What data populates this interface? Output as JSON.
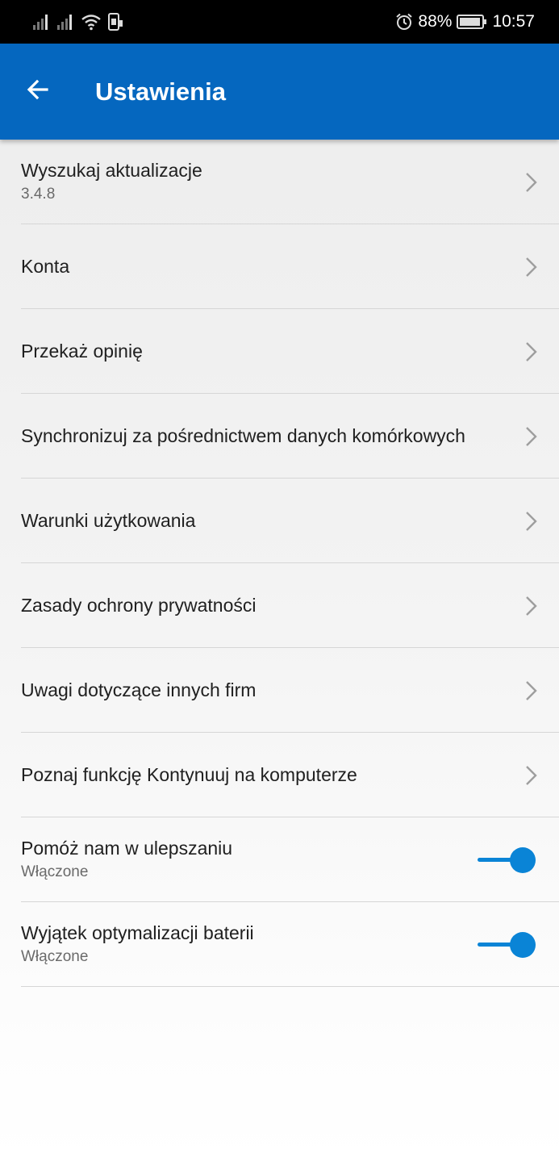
{
  "status_bar": {
    "battery_percent": "88%",
    "time": "10:57",
    "icons": [
      "signal-icon",
      "signal-icon",
      "wifi-icon",
      "sim-icon",
      "alarm-icon",
      "battery-icon"
    ]
  },
  "app_bar": {
    "title": "Ustawienia",
    "back_icon": "arrow-left-icon",
    "color": "#0567bf"
  },
  "settings": {
    "items": [
      {
        "title": "Wyszukaj aktualizacje",
        "subtitle": "3.4.8",
        "type": "link"
      },
      {
        "title": "Konta",
        "type": "link"
      },
      {
        "title": "Przekaż opinię",
        "type": "link"
      },
      {
        "title": "Synchronizuj za pośrednictwem danych komórkowych",
        "type": "link"
      },
      {
        "title": "Warunki użytkowania",
        "type": "link"
      },
      {
        "title": "Zasady ochrony prywatności",
        "type": "link"
      },
      {
        "title": "Uwagi dotyczące innych firm",
        "type": "link"
      },
      {
        "title": "Poznaj funkcję Kontynuuj na komputerze",
        "type": "link"
      },
      {
        "title": "Pomóż nam w ulepszaniu",
        "subtitle": "Włączone",
        "type": "toggle",
        "on": true
      },
      {
        "title": "Wyjątek optymalizacji baterii",
        "subtitle": "Włączone",
        "type": "toggle",
        "on": true
      }
    ]
  },
  "colors": {
    "accent": "#0a84d6",
    "chevron": "#9e9e9e"
  }
}
